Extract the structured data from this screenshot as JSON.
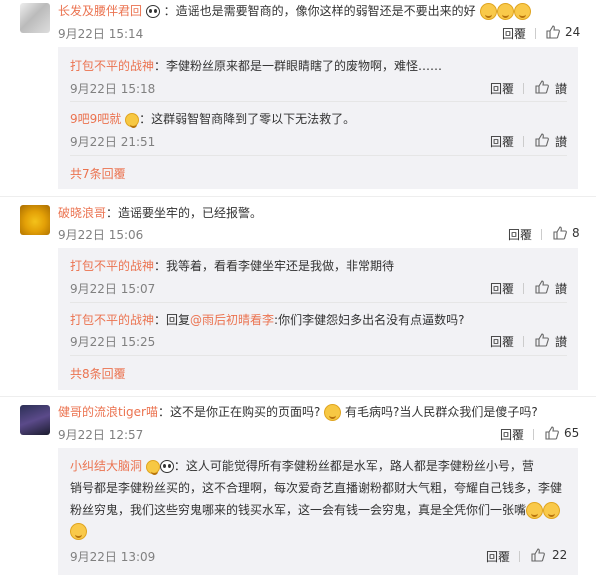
{
  "comments": [
    {
      "user": "长发及腰伴君回",
      "text": "：造谣也是需要智商的，像你这样的弱智还是不要出来的好",
      "time": "9月22日 15:14",
      "reply_label": "回覆",
      "likes": "24",
      "replies": [
        {
          "user": "打包不平的战神",
          "text": "：李健粉丝原来都是一群眼睛瞎了的废物啊，难怪……",
          "time": "9月22日 15:18",
          "reply_label": "回覆",
          "like_label": "讃"
        },
        {
          "user": "9吧9吧就",
          "text": "：这群弱智智商降到了零以下无法救了。",
          "time": "9月22日 21:51",
          "reply_label": "回覆",
          "like_label": "讃"
        }
      ],
      "more": "共7条回覆"
    },
    {
      "user": "破晓浪哥",
      "text": "：造谣要坐牢的，已经报警。",
      "time": "9月22日 15:06",
      "reply_label": "回覆",
      "likes": "8",
      "replies": [
        {
          "user": "打包不平的战神",
          "text": "：我等着，看看李健坐牢还是我做，非常期待",
          "time": "9月22日 15:07",
          "reply_label": "回覆",
          "like_label": "讃"
        },
        {
          "user": "打包不平的战神",
          "text_prefix": "：回复",
          "mention": "@雨后初晴看李",
          "text": ":你们李健怨妇多出名没有点逼数吗?",
          "time": "9月22日 15:25",
          "reply_label": "回覆",
          "like_label": "讃"
        }
      ],
      "more": "共8条回覆"
    },
    {
      "user": "健哥的流浪tiger喵",
      "text": "：这不是你正在购买的页面吗?",
      "text2": "有毛病吗?当人民群众我们是傻子吗?",
      "time": "9月22日 12:57",
      "reply_label": "回覆",
      "likes": "65",
      "replies": [
        {
          "user": "小纠结大脑洞",
          "line1": "：这人可能觉得所有李健粉丝都是水军，路人都是李健粉丝小号，营",
          "line2": "销号都是李健粉丝买的，这不合理啊，每次爱奇艺直播谢粉都财大气粗，夸耀自己钱多，李健",
          "line3": "粉丝穷鬼，我们这些穷鬼哪来的钱买水军，这一会有钱一会穷鬼，真是全凭你们一张嘴",
          "time": "9月22日 13:09",
          "reply_label": "回覆",
          "likes": "22"
        }
      ]
    }
  ],
  "icons": {
    "like": "thumb-up-icon",
    "emoji": "laugh-emoji-icon",
    "panda": "panda-emoji-icon"
  },
  "colors": {
    "link": "#eb7350",
    "text": "#333333",
    "meta": "#808080",
    "reply_bg": "#f2f2f5"
  }
}
